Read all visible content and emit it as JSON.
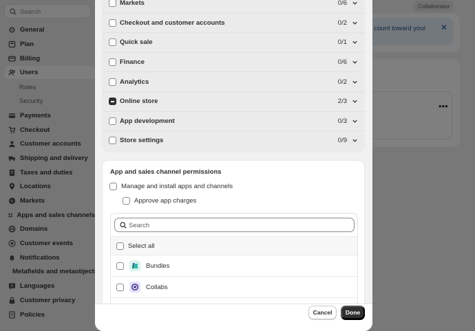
{
  "sidebar": {
    "search_placeholder": "Search",
    "items": [
      {
        "label": "General",
        "icon": "gear-icon"
      },
      {
        "label": "Plan",
        "icon": "plan-icon"
      },
      {
        "label": "Billing",
        "icon": "billing-icon"
      },
      {
        "label": "Users",
        "icon": "users-icon"
      },
      {
        "label": "Roles",
        "icon": ""
      },
      {
        "label": "Security",
        "icon": ""
      },
      {
        "label": "Payments",
        "icon": "payments-icon"
      },
      {
        "label": "Checkout",
        "icon": "cart-icon"
      },
      {
        "label": "Customer accounts",
        "icon": "person-icon"
      },
      {
        "label": "Shipping and delivery",
        "icon": "truck-icon"
      },
      {
        "label": "Taxes and duties",
        "icon": "tax-icon"
      },
      {
        "label": "Locations",
        "icon": "location-icon"
      },
      {
        "label": "Markets",
        "icon": "globe-icon"
      },
      {
        "label": "Apps and sales channels",
        "icon": "apps-icon"
      },
      {
        "label": "Domains",
        "icon": "globe-icon"
      },
      {
        "label": "Customer events",
        "icon": "events-icon"
      },
      {
        "label": "Notifications",
        "icon": "bell-icon"
      },
      {
        "label": "Metafields and metaobjects",
        "icon": "metafields-icon"
      },
      {
        "label": "Languages",
        "icon": "language-icon"
      },
      {
        "label": "Customer privacy",
        "icon": "privacy-icon"
      },
      {
        "label": "Policies",
        "icon": "policies-icon"
      }
    ]
  },
  "background": {
    "badge": "Collaborator",
    "banner_text": "t count toward your"
  },
  "permissions": [
    {
      "label": "Markets",
      "count": "0/6",
      "state": "unchecked"
    },
    {
      "label": "Checkout and customer accounts",
      "count": "0/2",
      "state": "unchecked"
    },
    {
      "label": "Quick sale",
      "count": "0/1",
      "state": "unchecked"
    },
    {
      "label": "Finance",
      "count": "0/6",
      "state": "unchecked"
    },
    {
      "label": "Analytics",
      "count": "0/2",
      "state": "unchecked"
    },
    {
      "label": "Online store",
      "count": "2/3",
      "state": "indeterminate"
    },
    {
      "label": "App development",
      "count": "0/3",
      "state": "unchecked"
    },
    {
      "label": "Store settings",
      "count": "0/9",
      "state": "unchecked"
    }
  ],
  "app_permissions": {
    "title": "App and sales channel permissions",
    "manage_label": "Manage and install apps and channels",
    "approve_label": "Approve app charges",
    "search_placeholder": "Search",
    "select_all_label": "Select all",
    "apps": [
      {
        "name": "Bundles",
        "color": "#2fb8a6"
      },
      {
        "name": "Collabs",
        "color": "#5c6ac4"
      }
    ]
  },
  "footer": {
    "cancel_label": "Cancel",
    "done_label": "Done"
  },
  "colors": {
    "primary_button": "#303030",
    "overlay": "rgba(0,0,0,0.5)"
  }
}
